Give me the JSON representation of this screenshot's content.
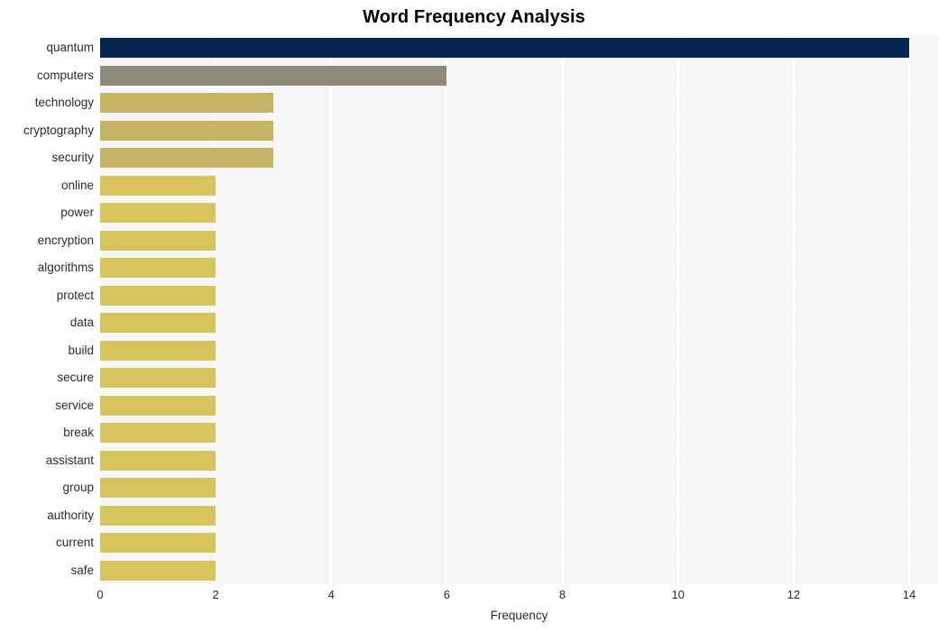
{
  "chart_data": {
    "type": "bar",
    "orientation": "horizontal",
    "title": "Word Frequency Analysis",
    "xlabel": "Frequency",
    "ylabel": "",
    "xlim": [
      0,
      14.5
    ],
    "xticks": [
      0,
      2,
      4,
      6,
      8,
      10,
      12,
      14
    ],
    "xtick_labels": [
      "0",
      "2",
      "4",
      "6",
      "8",
      "10",
      "12",
      "14"
    ],
    "grid": true,
    "grid_axis": "both",
    "legend": false,
    "plot_background": "#f6f6f6",
    "gridline_color": "#ffffff",
    "categories": [
      "quantum",
      "computers",
      "technology",
      "cryptography",
      "security",
      "online",
      "power",
      "encryption",
      "algorithms",
      "protect",
      "data",
      "build",
      "secure",
      "service",
      "break",
      "assistant",
      "group",
      "authority",
      "current",
      "safe"
    ],
    "values": [
      14,
      6,
      3,
      3,
      3,
      2,
      2,
      2,
      2,
      2,
      2,
      2,
      2,
      2,
      2,
      2,
      2,
      2,
      2,
      2
    ],
    "bar_colors": [
      "#05244f",
      "#8d8a7c",
      "#c4b464",
      "#c4b464",
      "#c4b464",
      "#d8c45c",
      "#d8c45c",
      "#d8c45c",
      "#d8c45c",
      "#d8c45c",
      "#d8c45c",
      "#d8c45c",
      "#d8c45c",
      "#d8c45c",
      "#d8c45c",
      "#d8c45c",
      "#d8c45c",
      "#d8c45c",
      "#d8c45c",
      "#d8c45c"
    ]
  }
}
